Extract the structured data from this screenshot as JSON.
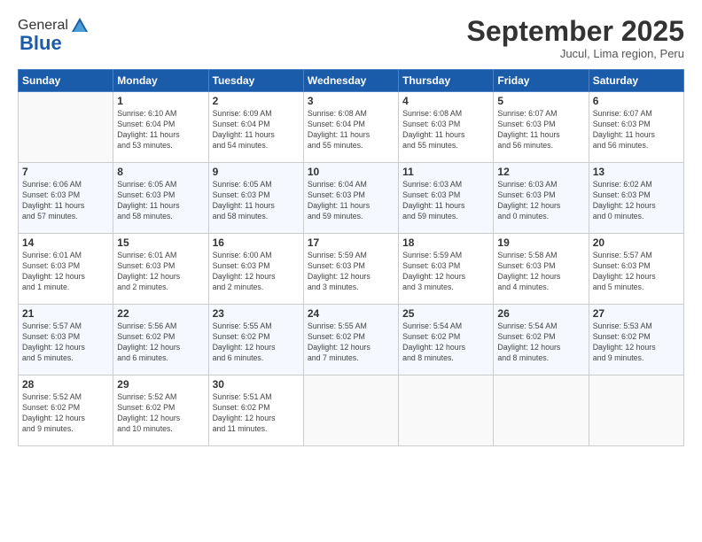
{
  "logo": {
    "general": "General",
    "blue": "Blue"
  },
  "header": {
    "month": "September 2025",
    "location": "Jucul, Lima region, Peru"
  },
  "days_of_week": [
    "Sunday",
    "Monday",
    "Tuesday",
    "Wednesday",
    "Thursday",
    "Friday",
    "Saturday"
  ],
  "weeks": [
    [
      {
        "day": "",
        "info": ""
      },
      {
        "day": "1",
        "info": "Sunrise: 6:10 AM\nSunset: 6:04 PM\nDaylight: 11 hours\nand 53 minutes."
      },
      {
        "day": "2",
        "info": "Sunrise: 6:09 AM\nSunset: 6:04 PM\nDaylight: 11 hours\nand 54 minutes."
      },
      {
        "day": "3",
        "info": "Sunrise: 6:08 AM\nSunset: 6:04 PM\nDaylight: 11 hours\nand 55 minutes."
      },
      {
        "day": "4",
        "info": "Sunrise: 6:08 AM\nSunset: 6:03 PM\nDaylight: 11 hours\nand 55 minutes."
      },
      {
        "day": "5",
        "info": "Sunrise: 6:07 AM\nSunset: 6:03 PM\nDaylight: 11 hours\nand 56 minutes."
      },
      {
        "day": "6",
        "info": "Sunrise: 6:07 AM\nSunset: 6:03 PM\nDaylight: 11 hours\nand 56 minutes."
      }
    ],
    [
      {
        "day": "7",
        "info": "Sunrise: 6:06 AM\nSunset: 6:03 PM\nDaylight: 11 hours\nand 57 minutes."
      },
      {
        "day": "8",
        "info": "Sunrise: 6:05 AM\nSunset: 6:03 PM\nDaylight: 11 hours\nand 58 minutes."
      },
      {
        "day": "9",
        "info": "Sunrise: 6:05 AM\nSunset: 6:03 PM\nDaylight: 11 hours\nand 58 minutes."
      },
      {
        "day": "10",
        "info": "Sunrise: 6:04 AM\nSunset: 6:03 PM\nDaylight: 11 hours\nand 59 minutes."
      },
      {
        "day": "11",
        "info": "Sunrise: 6:03 AM\nSunset: 6:03 PM\nDaylight: 11 hours\nand 59 minutes."
      },
      {
        "day": "12",
        "info": "Sunrise: 6:03 AM\nSunset: 6:03 PM\nDaylight: 12 hours\nand 0 minutes."
      },
      {
        "day": "13",
        "info": "Sunrise: 6:02 AM\nSunset: 6:03 PM\nDaylight: 12 hours\nand 0 minutes."
      }
    ],
    [
      {
        "day": "14",
        "info": "Sunrise: 6:01 AM\nSunset: 6:03 PM\nDaylight: 12 hours\nand 1 minute."
      },
      {
        "day": "15",
        "info": "Sunrise: 6:01 AM\nSunset: 6:03 PM\nDaylight: 12 hours\nand 2 minutes."
      },
      {
        "day": "16",
        "info": "Sunrise: 6:00 AM\nSunset: 6:03 PM\nDaylight: 12 hours\nand 2 minutes."
      },
      {
        "day": "17",
        "info": "Sunrise: 5:59 AM\nSunset: 6:03 PM\nDaylight: 12 hours\nand 3 minutes."
      },
      {
        "day": "18",
        "info": "Sunrise: 5:59 AM\nSunset: 6:03 PM\nDaylight: 12 hours\nand 3 minutes."
      },
      {
        "day": "19",
        "info": "Sunrise: 5:58 AM\nSunset: 6:03 PM\nDaylight: 12 hours\nand 4 minutes."
      },
      {
        "day": "20",
        "info": "Sunrise: 5:57 AM\nSunset: 6:03 PM\nDaylight: 12 hours\nand 5 minutes."
      }
    ],
    [
      {
        "day": "21",
        "info": "Sunrise: 5:57 AM\nSunset: 6:03 PM\nDaylight: 12 hours\nand 5 minutes."
      },
      {
        "day": "22",
        "info": "Sunrise: 5:56 AM\nSunset: 6:02 PM\nDaylight: 12 hours\nand 6 minutes."
      },
      {
        "day": "23",
        "info": "Sunrise: 5:55 AM\nSunset: 6:02 PM\nDaylight: 12 hours\nand 6 minutes."
      },
      {
        "day": "24",
        "info": "Sunrise: 5:55 AM\nSunset: 6:02 PM\nDaylight: 12 hours\nand 7 minutes."
      },
      {
        "day": "25",
        "info": "Sunrise: 5:54 AM\nSunset: 6:02 PM\nDaylight: 12 hours\nand 8 minutes."
      },
      {
        "day": "26",
        "info": "Sunrise: 5:54 AM\nSunset: 6:02 PM\nDaylight: 12 hours\nand 8 minutes."
      },
      {
        "day": "27",
        "info": "Sunrise: 5:53 AM\nSunset: 6:02 PM\nDaylight: 12 hours\nand 9 minutes."
      }
    ],
    [
      {
        "day": "28",
        "info": "Sunrise: 5:52 AM\nSunset: 6:02 PM\nDaylight: 12 hours\nand 9 minutes."
      },
      {
        "day": "29",
        "info": "Sunrise: 5:52 AM\nSunset: 6:02 PM\nDaylight: 12 hours\nand 10 minutes."
      },
      {
        "day": "30",
        "info": "Sunrise: 5:51 AM\nSunset: 6:02 PM\nDaylight: 12 hours\nand 11 minutes."
      },
      {
        "day": "",
        "info": ""
      },
      {
        "day": "",
        "info": ""
      },
      {
        "day": "",
        "info": ""
      },
      {
        "day": "",
        "info": ""
      }
    ]
  ]
}
